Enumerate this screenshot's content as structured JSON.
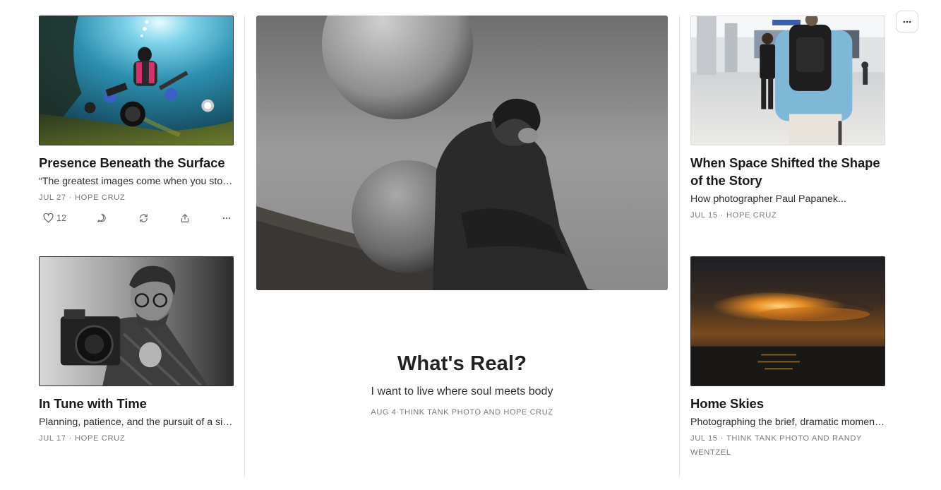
{
  "more_menu_icon": "more-horizontal-icon",
  "posts": {
    "p1": {
      "title": "Presence Beneath the Surface",
      "subtitle": "“The greatest images come when you stop trying to control everything”",
      "date": "JUL 27",
      "author": "HOPE CRUZ",
      "likes": "12",
      "actions": [
        "heart-icon",
        "comment-icon",
        "restack-icon",
        "share-icon",
        "more-horizontal-icon"
      ]
    },
    "p2": {
      "title": "In Tune with Time",
      "subtitle": "Planning, patience, and the pursuit of a single frame",
      "date": "JUL 17",
      "author": "HOPE CRUZ"
    },
    "feature": {
      "title": "What's Real?",
      "subtitle": "I want to live where soul meets body",
      "date": "AUG 4",
      "author": "THINK TANK PHOTO AND HOPE CRUZ"
    },
    "p3": {
      "title": "When Space Shifted the Shape of the Story",
      "subtitle": "How photographer Paul Papanek...",
      "date": "JUL 15",
      "author": "HOPE CRUZ"
    },
    "p4": {
      "title": "Home Skies",
      "subtitle": "Photographing the brief, dramatic moments of the sky at home",
      "date": "JUL 15",
      "author": "THINK TANK PHOTO AND RANDY WENTZEL"
    }
  },
  "meta_separator": "·"
}
